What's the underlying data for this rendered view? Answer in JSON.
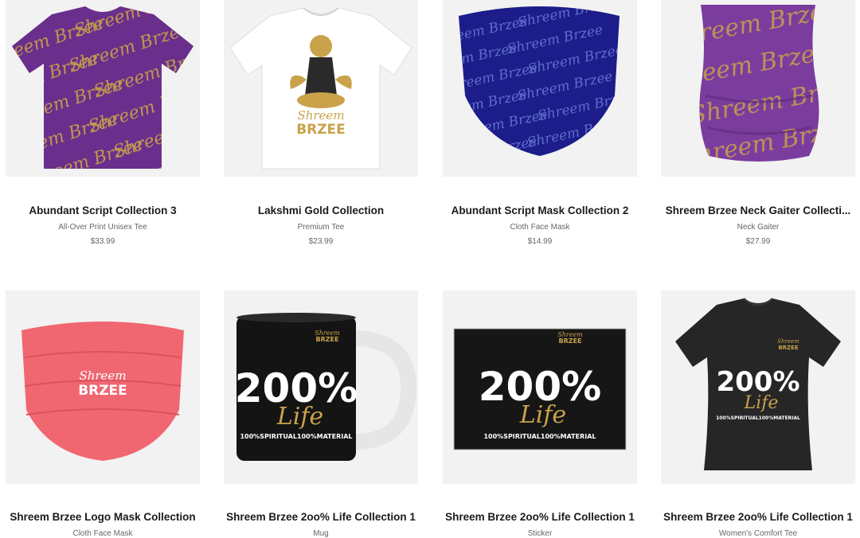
{
  "products": [
    {
      "title": "Abundant Script Collection 3",
      "type": "All-Over Print Unisex Tee",
      "price": "$33.99",
      "image_icon": "purple-script-tshirt-image"
    },
    {
      "title": "Lakshmi Gold Collection",
      "type": "Premium Tee",
      "price": "$23.99",
      "image_icon": "white-lakshmi-tshirt-image"
    },
    {
      "title": "Abundant Script Mask Collection 2",
      "type": "Cloth Face Mask",
      "price": "$14.99",
      "image_icon": "blue-script-mask-image"
    },
    {
      "title": "Shreem Brzee Neck Gaiter Collecti...",
      "type": "Neck Gaiter",
      "price": "$27.99",
      "image_icon": "purple-neck-gaiter-image"
    },
    {
      "title": "Shreem Brzee Logo Mask Collection",
      "type": "Cloth Face Mask",
      "image_icon": "pink-logo-mask-image"
    },
    {
      "title": "Shreem Brzee 2oo% Life Collection 1",
      "type": "Mug",
      "image_icon": "black-mug-image"
    },
    {
      "title": "Shreem Brzee 2oo% Life Collection 1",
      "type": "Sticker",
      "image_icon": "black-sticker-image"
    },
    {
      "title": "Shreem Brzee 2oo% Life Collection 1",
      "type": "Women's Comfort Tee",
      "image_icon": "black-womens-tee-image"
    }
  ],
  "artwork": {
    "script_text": "Shreem Brzee",
    "logo_script": "Shreem",
    "logo_word": "BRZEE",
    "big_number": "200%",
    "big_word": "Life",
    "tagline": "100%SPIRITUAL100%MATERIAL"
  },
  "colors": {
    "thumb_bg": "#f2f2f2",
    "purple": "#6a2f8c",
    "gold": "#c9a24a",
    "navy": "#1c1d8a",
    "coral": "#f06772",
    "black": "#222222"
  }
}
